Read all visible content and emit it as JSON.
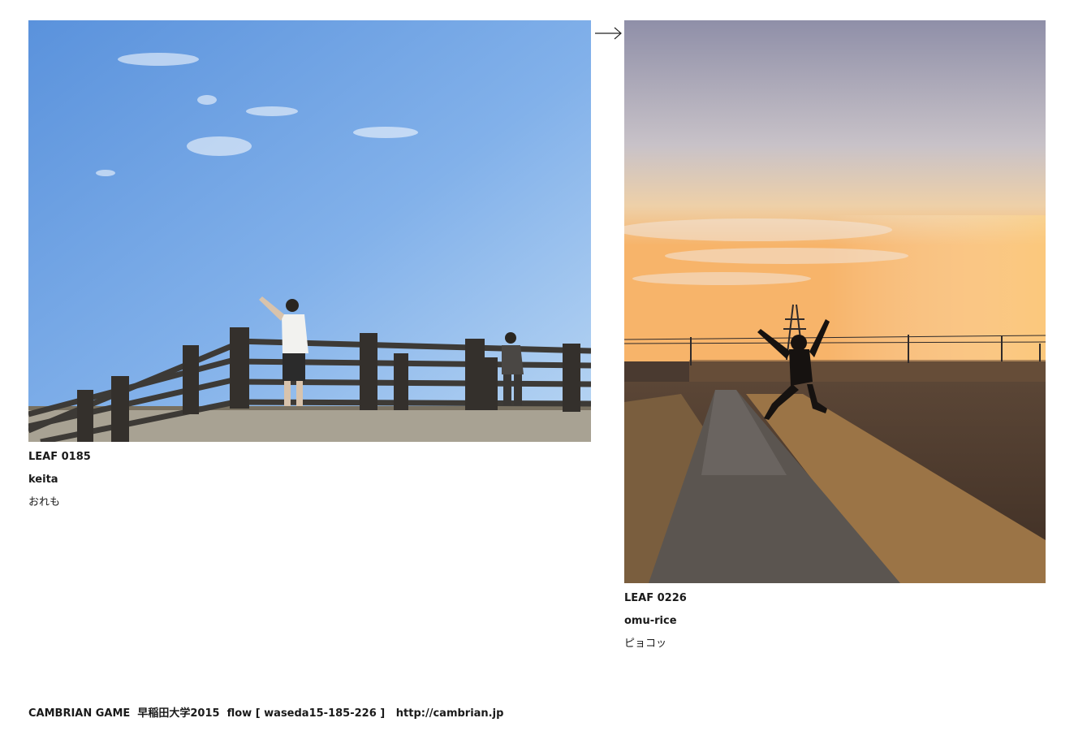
{
  "left_leaf": {
    "number": "LEAF 0185",
    "author": "keita",
    "caption": "おれも"
  },
  "right_leaf": {
    "number": "LEAF 0226",
    "author": "omu-rice",
    "caption": "ピョコッ"
  },
  "arrow_icon": "right-arrow-icon",
  "footer": {
    "text": "CAMBRIAN GAME  早稲田大学2015  flow [ waseda15-185-226 ]   http://cambrian.jp"
  }
}
